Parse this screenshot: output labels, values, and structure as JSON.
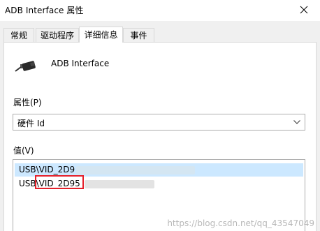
{
  "window": {
    "title": "ADB Interface 属性",
    "close_icon": "close-icon"
  },
  "tabs": [
    {
      "label": "常规",
      "active": false
    },
    {
      "label": "驱动程序",
      "active": false
    },
    {
      "label": "详细信息",
      "active": true
    },
    {
      "label": "事件",
      "active": false
    }
  ],
  "device": {
    "icon": "usb-plug-icon",
    "name": "ADB Interface"
  },
  "property": {
    "label": "属性(P)",
    "selected": "硬件 Id"
  },
  "value": {
    "label": "值(V)",
    "rows": [
      {
        "text": "USB\\VID_2D9",
        "selected": true
      },
      {
        "text": "USB\\VID_2D95",
        "selected": false
      }
    ]
  },
  "watermark": "https://blog.csdn.net/qq_43547049",
  "colors": {
    "selection": "#cce8ff",
    "highlight_box": "#e5202a",
    "dialog_background": "#f0f0f0"
  }
}
